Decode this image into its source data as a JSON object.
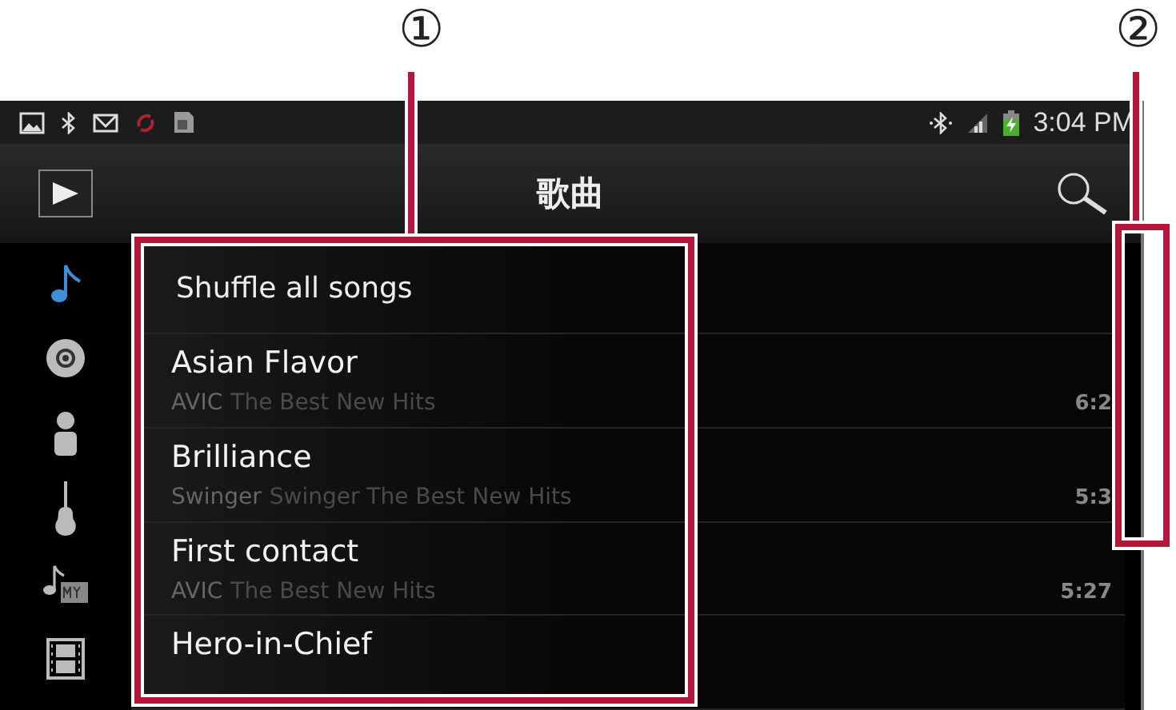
{
  "callouts": [
    {
      "label": "①"
    },
    {
      "label": "②"
    }
  ],
  "status_bar": {
    "time": "3:04 PM"
  },
  "action_bar": {
    "title": "歌曲"
  },
  "sidebar": {
    "items": [
      {
        "selected": true
      },
      {
        "selected": false
      },
      {
        "selected": false
      },
      {
        "selected": false
      },
      {
        "selected": false
      },
      {
        "selected": false
      }
    ]
  },
  "list": {
    "shuffle": "Shuffle all songs",
    "songs": [
      {
        "title": "Asian Flavor",
        "artist": "AVIC",
        "album": "The Best New Hits",
        "duration": "6:2"
      },
      {
        "title": "Brilliance",
        "artist": "Swinger",
        "album": "Swinger The Best New Hits",
        "duration": "5:3"
      },
      {
        "title": "First contact",
        "artist": "AVIC",
        "album": "The Best New Hits",
        "duration": "5:27"
      },
      {
        "title": "Hero-in-Chief"
      }
    ]
  }
}
